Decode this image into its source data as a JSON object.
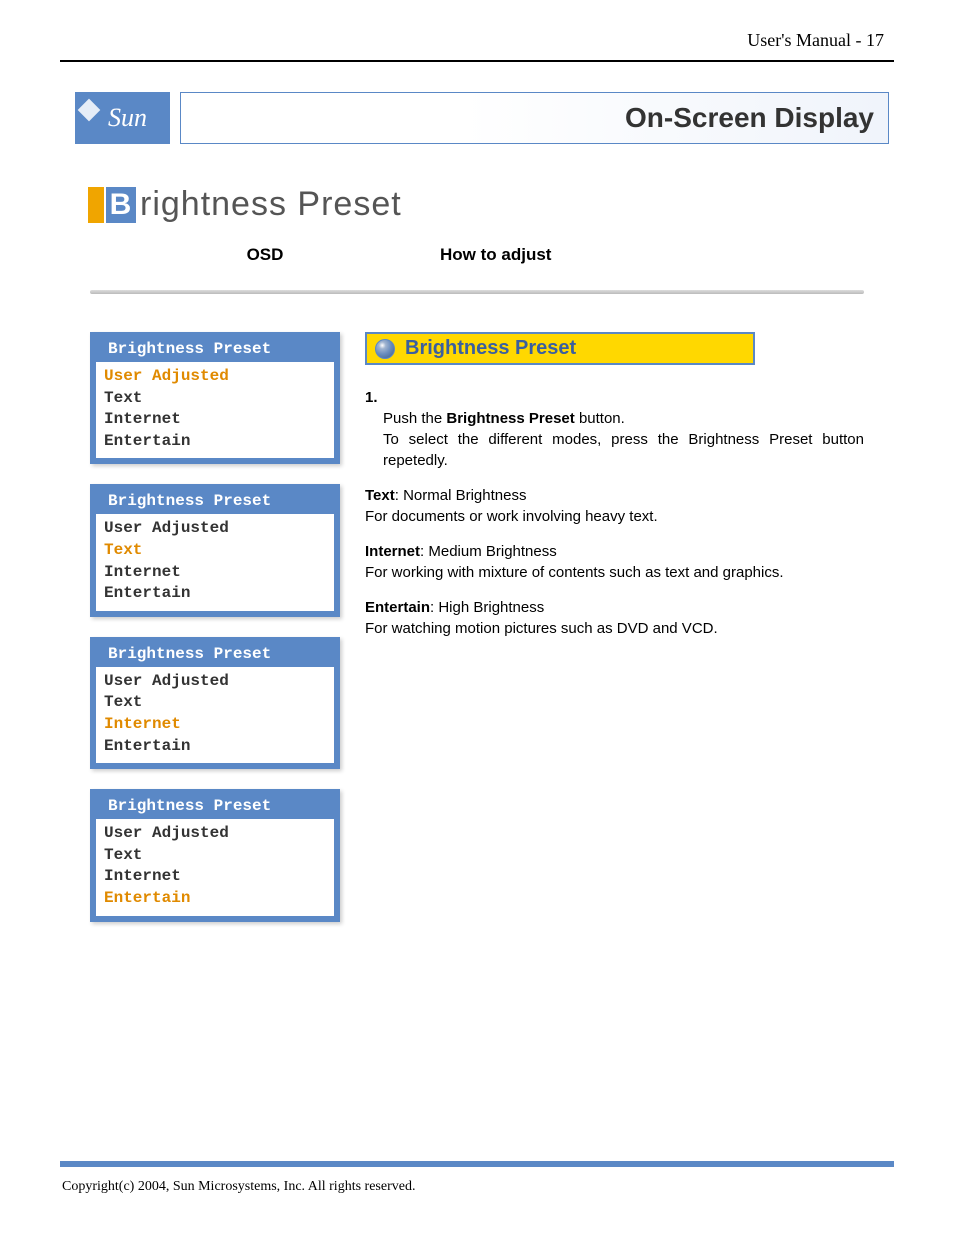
{
  "page_header": "User's Manual - 17",
  "brand": "Sun",
  "section_title": "On-Screen Display",
  "main_heading": {
    "first_letter": "B",
    "rest": "rightness Preset"
  },
  "columns": {
    "osd": "OSD",
    "how": "How to adjust"
  },
  "osd_panels": [
    {
      "title": "Brightness Preset",
      "items": [
        "User Adjusted",
        "Text",
        "Internet",
        "Entertain"
      ],
      "selected": 0
    },
    {
      "title": "Brightness Preset",
      "items": [
        "User Adjusted",
        "Text",
        "Internet",
        "Entertain"
      ],
      "selected": 1
    },
    {
      "title": "Brightness Preset",
      "items": [
        "User Adjusted",
        "Text",
        "Internet",
        "Entertain"
      ],
      "selected": 2
    },
    {
      "title": "Brightness Preset",
      "items": [
        "User Adjusted",
        "Text",
        "Internet",
        "Entertain"
      ],
      "selected": 3
    }
  ],
  "yellow_title": "Brightness Preset",
  "step": {
    "num": "1.",
    "prefix": "Push the ",
    "bold": "Brightness Preset",
    "suffix": " button.",
    "line2": "To select the different modes, press the Brightness Preset button repetedly."
  },
  "modes": [
    {
      "name": "Text",
      "tag": ": Normal Brightness",
      "desc": "For documents or work involving heavy text."
    },
    {
      "name": "Internet",
      "tag": ": Medium Brightness",
      "desc": "For working with mixture of contents such as text and graphics."
    },
    {
      "name": "Entertain",
      "tag": ": High Brightness",
      "desc": "For watching motion pictures such as DVD and VCD."
    }
  ],
  "footer": "Copyright(c) 2004, Sun Microsystems, Inc. All rights reserved."
}
